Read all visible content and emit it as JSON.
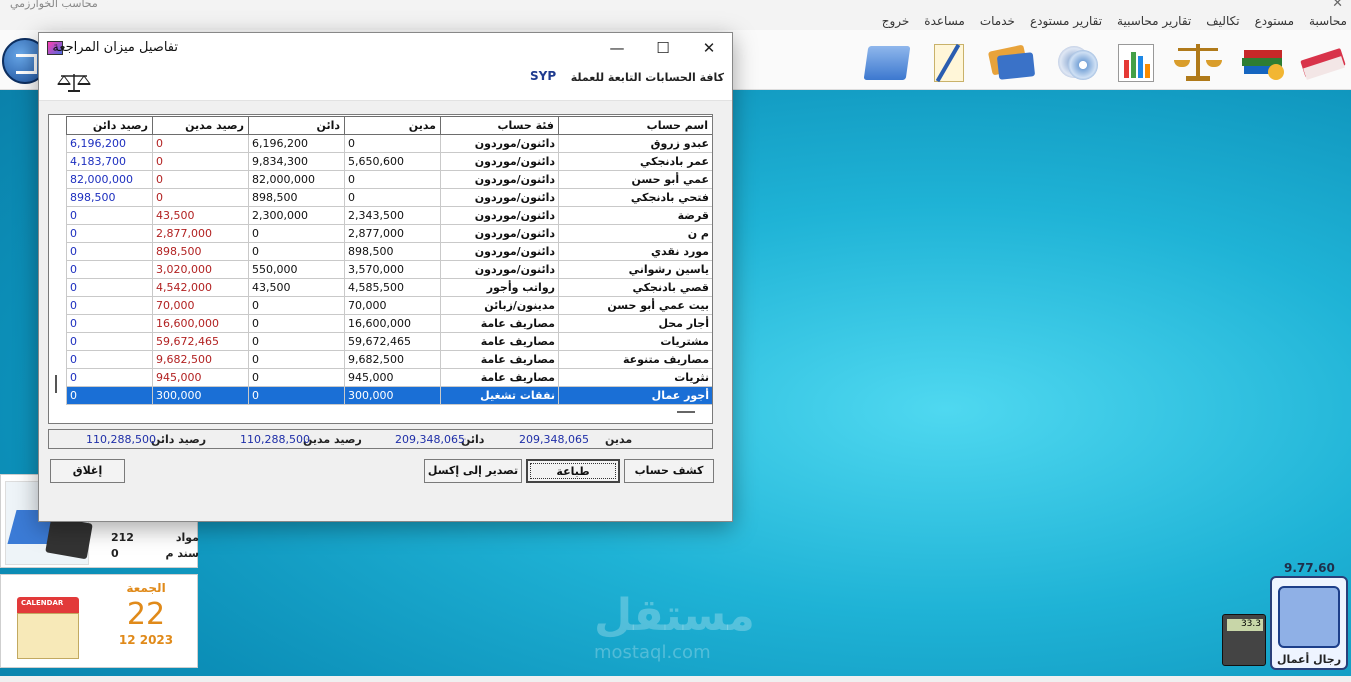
{
  "app": {
    "title": "محاسب الخوارزمي",
    "close_glyph": "✕"
  },
  "menubar": [
    "محاسبة",
    "مستودع",
    "تكاليف",
    "تقارير محاسبية",
    "تقارير مستودع",
    "خدمات",
    "مساعدة",
    "خروج"
  ],
  "toolbar": {
    "icons": [
      "books-icon",
      "stack-books-icon",
      "scale-icon",
      "chart-report-icon",
      "discs-icon",
      "cards-icon",
      "document-pen-icon",
      "folder-icon"
    ]
  },
  "dialog": {
    "title": "تفاصيل ميزان المراجعة",
    "currency_caption": "كافة الحسابات التابعة للعملة",
    "currency_code": "SYP",
    "columns": [
      "اسم حساب",
      "فئة حساب",
      "مدين",
      "دائن",
      "رصيد مدين",
      "رصيد دائن"
    ],
    "rows": [
      {
        "name": "عبدو زروق",
        "category": "دائنون/موردون",
        "debit": "0",
        "credit": "6,196,200",
        "debit_balance": "0",
        "credit_balance": "6,196,200"
      },
      {
        "name": "عمر بادنجكي",
        "category": "دائنون/موردون",
        "debit": "5,650,600",
        "credit": "9,834,300",
        "debit_balance": "0",
        "credit_balance": "4,183,700"
      },
      {
        "name": "عمي أبو حسن",
        "category": "دائنون/موردون",
        "debit": "0",
        "credit": "82,000,000",
        "debit_balance": "0",
        "credit_balance": "82,000,000"
      },
      {
        "name": "فتحي بادنجكي",
        "category": "دائنون/موردون",
        "debit": "0",
        "credit": "898,500",
        "debit_balance": "0",
        "credit_balance": "898,500"
      },
      {
        "name": "قرضة",
        "category": "دائنون/موردون",
        "debit": "2,343,500",
        "credit": "2,300,000",
        "debit_balance": "43,500",
        "credit_balance": "0"
      },
      {
        "name": "م ن",
        "category": "دائنون/موردون",
        "debit": "2,877,000",
        "credit": "0",
        "debit_balance": "2,877,000",
        "credit_balance": "0"
      },
      {
        "name": "مورد نقدي",
        "category": "دائنون/موردون",
        "debit": "898,500",
        "credit": "0",
        "debit_balance": "898,500",
        "credit_balance": "0"
      },
      {
        "name": "ياسين رشواني",
        "category": "دائنون/موردون",
        "debit": "3,570,000",
        "credit": "550,000",
        "debit_balance": "3,020,000",
        "credit_balance": "0"
      },
      {
        "name": "قصي بادنجكي",
        "category": "رواتب وأجور",
        "debit": "4,585,500",
        "credit": "43,500",
        "debit_balance": "4,542,000",
        "credit_balance": "0"
      },
      {
        "name": "بيت عمي أبو حسن",
        "category": "مدينون/زبائن",
        "debit": "70,000",
        "credit": "0",
        "debit_balance": "70,000",
        "credit_balance": "0"
      },
      {
        "name": "أجار محل",
        "category": "مصاريف عامة",
        "debit": "16,600,000",
        "credit": "0",
        "debit_balance": "16,600,000",
        "credit_balance": "0"
      },
      {
        "name": "مشتريات",
        "category": "مصاريف عامة",
        "debit": "59,672,465",
        "credit": "0",
        "debit_balance": "59,672,465",
        "credit_balance": "0"
      },
      {
        "name": "مصاريف متنوعة",
        "category": "مصاريف عامة",
        "debit": "9,682,500",
        "credit": "0",
        "debit_balance": "9,682,500",
        "credit_balance": "0"
      },
      {
        "name": "نثريات",
        "category": "مصاريف عامة",
        "debit": "945,000",
        "credit": "0",
        "debit_balance": "945,000",
        "credit_balance": "0"
      },
      {
        "name": "أجور عمال",
        "category": "نفقات تشغيل",
        "debit": "300,000",
        "credit": "0",
        "debit_balance": "300,000",
        "credit_balance": "0",
        "selected": true
      }
    ],
    "totals": {
      "debit_label": "مدين",
      "debit_value": "209,348,065",
      "credit_label": "دائن",
      "credit_value": "209,348,065",
      "debit_balance_label": "رصيد مدين",
      "debit_balance_value": "110,288,500",
      "credit_balance_label": "رصيد دائن",
      "credit_balance_value": "110,288,500"
    },
    "buttons": {
      "account_statement": "كشف حساب",
      "print": "طباعة",
      "export_excel": "تصدير إلى إكسل",
      "close": "إغلاق"
    }
  },
  "stats_card": {
    "rows": [
      {
        "label": "مواد",
        "value": "212"
      },
      {
        "label": "سند م",
        "value": "0"
      }
    ]
  },
  "date_card": {
    "day_name": "الجمعة",
    "day": "22",
    "month_year": "12  2023",
    "calendar_word": "CALENDAR"
  },
  "version": "9.77.60",
  "business_button": {
    "label": "رجال أعمال"
  },
  "calculator": {
    "display": "33.3"
  },
  "watermark": {
    "text": "مستقل",
    "sub": "mostaql.com"
  }
}
